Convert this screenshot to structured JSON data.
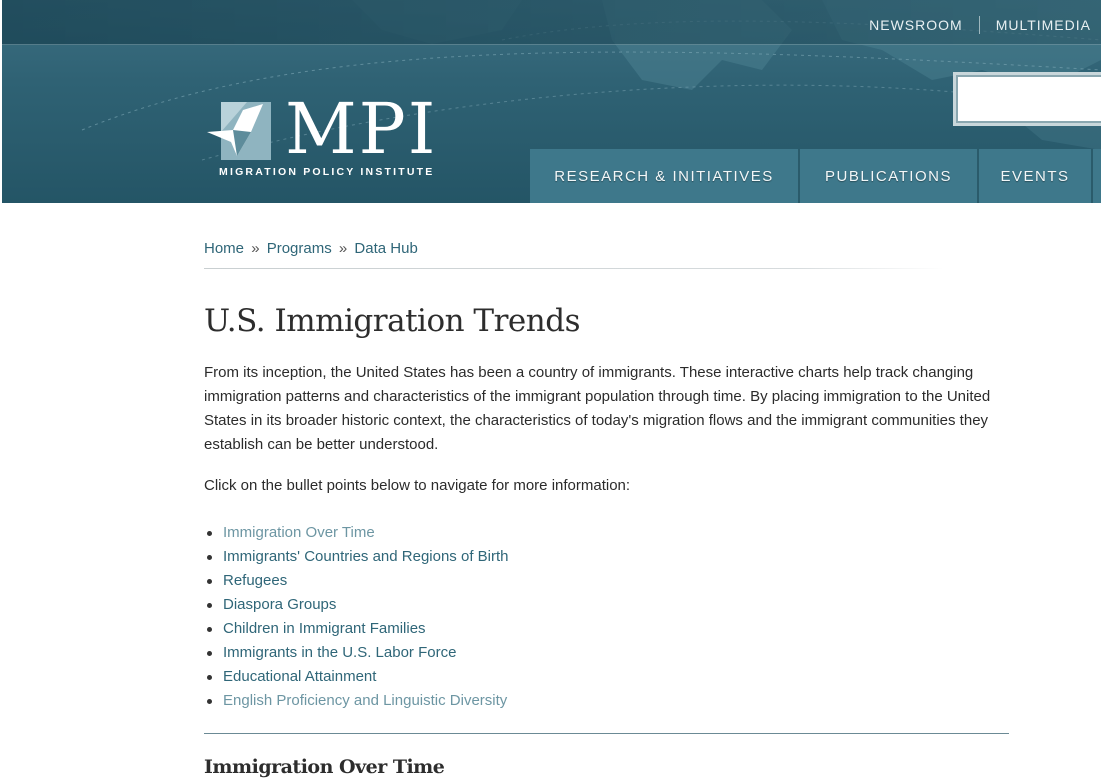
{
  "header": {
    "utility_links": [
      "NEWSROOM",
      "MULTIMEDIA"
    ],
    "logo": {
      "text": "MPI",
      "subtitle": "MIGRATION POLICY INSTITUTE"
    },
    "search": {
      "placeholder": ""
    },
    "main_nav": [
      "RESEARCH & INITIATIVES",
      "PUBLICATIONS",
      "EVENTS"
    ]
  },
  "breadcrumb": {
    "items": [
      "Home",
      "Programs",
      "Data Hub"
    ],
    "separator": "»"
  },
  "page": {
    "title": "U.S. Immigration Trends",
    "intro": "From its inception, the United States has been a country of immigrants. These interactive charts help track changing immigration patterns and characteristics of the immigrant population through time. By placing immigration to the United States in its broader historic context, the characteristics of today's migration flows and the immigrant communities they establish can be better understood.",
    "nav_help": "Click on the bullet points below to navigate for more information:",
    "topics": [
      "Immigration Over Time",
      "Immigrants' Countries and Regions of Birth",
      "Refugees",
      "Diaspora Groups",
      "Children in Immigrant Families",
      "Immigrants in the U.S. Labor Force",
      "Educational Attainment",
      "English Proficiency and Linguistic Diversity"
    ],
    "section_heading": "Immigration Over Time"
  },
  "colors": {
    "header_bg": "#2f6274",
    "nav_bg": "#3e788b",
    "link": "#2f6678",
    "visited_link": "#6d96a3"
  }
}
